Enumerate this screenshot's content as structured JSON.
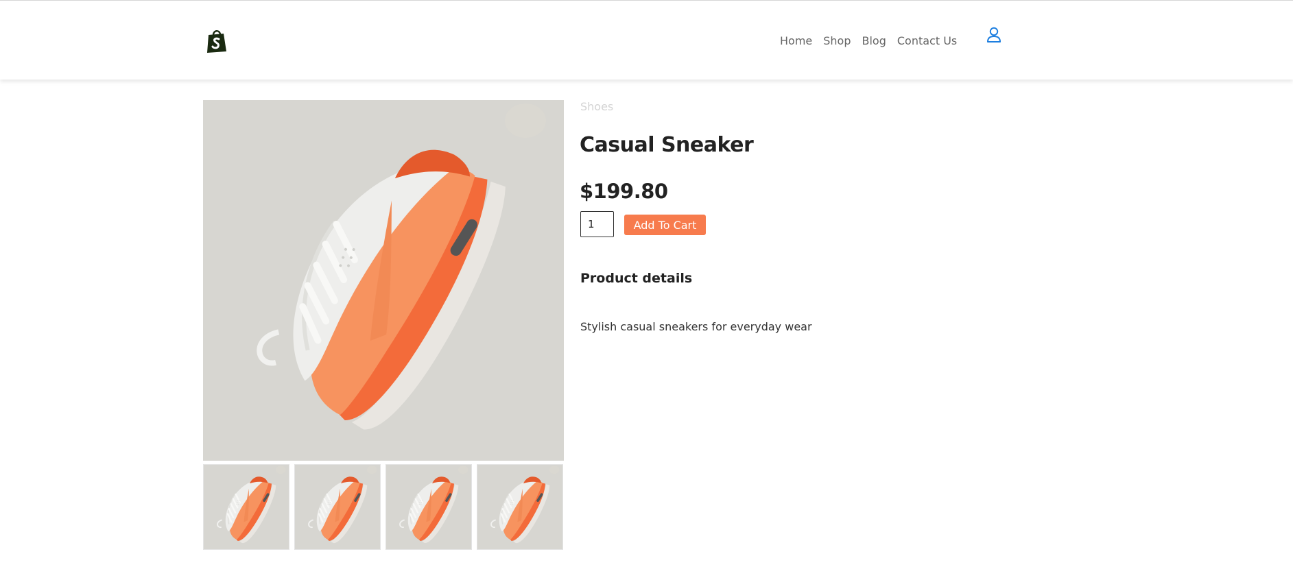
{
  "header": {
    "logo_icon": "shopify-bag-icon",
    "nav": [
      {
        "label": "Home"
      },
      {
        "label": "Shop"
      },
      {
        "label": "Blog"
      },
      {
        "label": "Contact Us"
      }
    ],
    "user_icon": "user-icon",
    "accent_color": "#1e7fe0"
  },
  "gallery": {
    "main_image": "sneaker-photo",
    "thumbnails": [
      "sneaker-photo",
      "sneaker-photo",
      "sneaker-photo",
      "sneaker-photo"
    ]
  },
  "product": {
    "category": "Shoes",
    "title": "Casual Sneaker",
    "price": "$199.80",
    "quantity": "1",
    "add_to_cart_label": "Add To Cart",
    "button_color": "#f77b4d",
    "details_heading": "Product details",
    "description": "Stylish casual sneakers for everyday wear"
  }
}
